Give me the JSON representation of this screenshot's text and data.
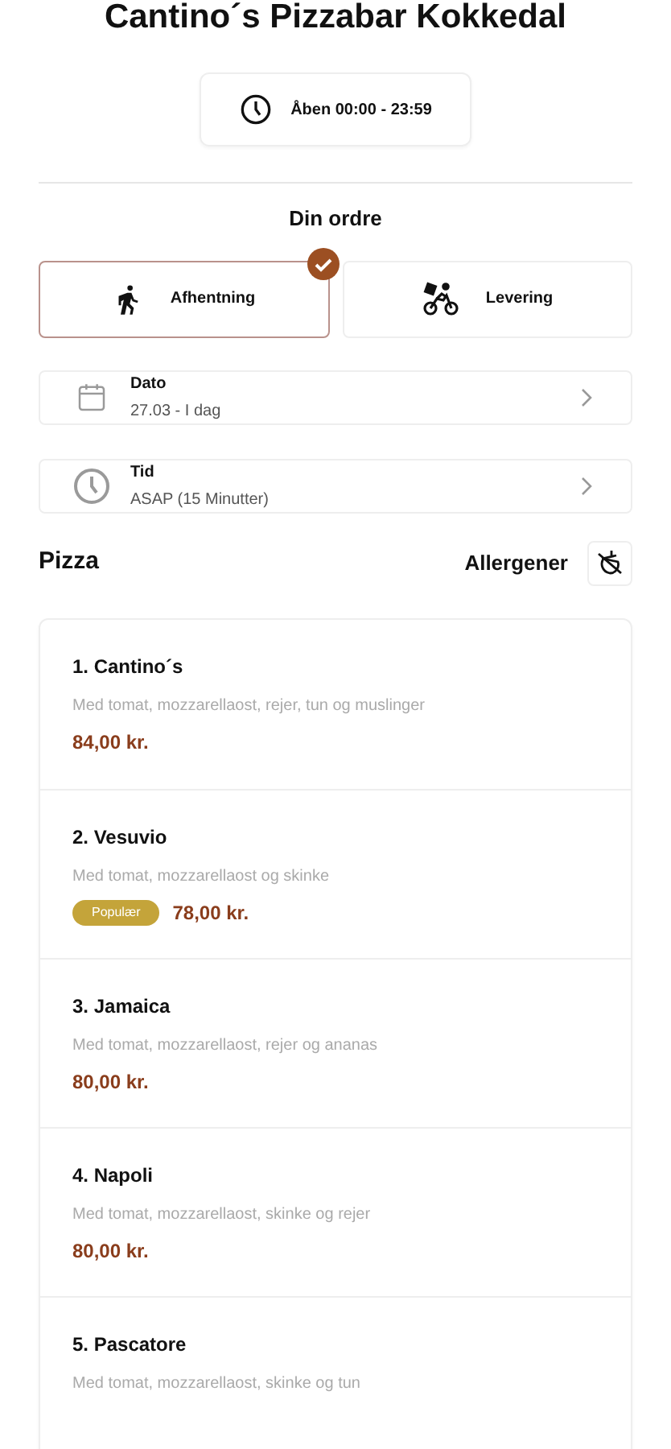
{
  "title": "Cantino´s Pizzabar Kokkedal",
  "opening_hours": "Åben 00:00 - 23:59",
  "order_heading": "Din ordre",
  "order_modes": [
    {
      "kind": "pickup",
      "label": "Afhentning",
      "selected": true
    },
    {
      "kind": "delivery",
      "label": "Levering",
      "selected": false
    }
  ],
  "pickers": [
    {
      "kind": "date",
      "label": "Dato",
      "value": "27.03 - I dag"
    },
    {
      "kind": "time",
      "label": "Tid",
      "value": "ASAP (15 Minutter)"
    }
  ],
  "section": {
    "title": "Pizza",
    "allergens_label": "Allergener"
  },
  "items": [
    {
      "name": "1. Cantino´s",
      "description": "Med tomat, mozzarellaost, rejer, tun og muslinger",
      "price": "84,00 kr."
    },
    {
      "name": "2. Vesuvio",
      "description": "Med tomat, mozzarellaost og skinke",
      "badge": "Populær",
      "price": "78,00 kr."
    },
    {
      "name": "3. Jamaica",
      "description": "Med tomat, mozzarellaost, rejer og ananas",
      "price": "80,00 kr."
    },
    {
      "name": "4. Napoli",
      "description": "Med tomat, mozzarellaost, skinke og rejer",
      "price": "80,00 kr."
    },
    {
      "name": "5. Pascatore",
      "description": "Med tomat, mozzarellaost, skinke og tun"
    }
  ]
}
